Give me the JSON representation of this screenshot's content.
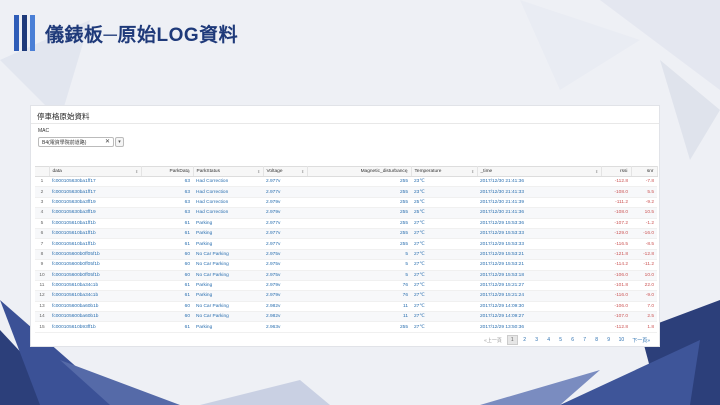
{
  "title": "儀錶板─原始LOG資料",
  "colors": {
    "title": "#1f3a7a",
    "bar1": "#2f5db8",
    "bar2": "#1f3a7a",
    "bar3": "#4a7fd6",
    "link": "#2a6fb0"
  },
  "panel": {
    "title": "停車格原始資料",
    "mac_label": "MAC",
    "mac_value": "B4(電資學院前道路)",
    "clear_icon": "✕",
    "dropdown_icon": "▾"
  },
  "table": {
    "columns": [
      "data",
      "ParkData",
      "ParkStatus",
      "Voltage",
      "Magnetic_disturbance",
      "Temperature",
      "_time",
      "rssi",
      "snr"
    ],
    "rows": [
      [
        "1",
        "fc000105630ba1ff17",
        "63",
        "Had Correction",
        "2.977v",
        "255",
        "23℃",
        "2017/12/30 21:41:36",
        "-112.8",
        "-7.8"
      ],
      [
        "2",
        "fc000105630ba1ff17",
        "63",
        "Had Correction",
        "2.977v",
        "255",
        "23℃",
        "2017/12/30 21:41:33",
        "-108.0",
        "5.5"
      ],
      [
        "3",
        "fc000105630ba3ff19",
        "63",
        "Had Correction",
        "2.979v",
        "255",
        "25℃",
        "2017/12/30 21:41:39",
        "-111.2",
        "-9.2"
      ],
      [
        "4",
        "fc000105630ba3ff19",
        "63",
        "Had Correction",
        "2.979v",
        "255",
        "25℃",
        "2017/12/30 21:41:36",
        "-108.0",
        "10.5"
      ],
      [
        "5",
        "fc000105610ba1ff1b",
        "61",
        "Parking",
        "2.977v",
        "255",
        "27℃",
        "2017/12/29 15:53:36",
        "-107.2",
        "-1.2"
      ],
      [
        "6",
        "fc000105610ba1ff1b",
        "61",
        "Parking",
        "2.977v",
        "255",
        "27℃",
        "2017/12/29 15:53:33",
        "-129.0",
        "-16.0"
      ],
      [
        "7",
        "fc000105610ba1ff1b",
        "61",
        "Parking",
        "2.977v",
        "255",
        "27℃",
        "2017/12/29 15:53:33",
        "-116.5",
        "-8.5"
      ],
      [
        "8",
        "fc000105600b0ff05f1b",
        "60",
        "No Car Parking",
        "2.975v",
        "5",
        "27℃",
        "2017/12/29 15:53:21",
        "-121.8",
        "-12.8"
      ],
      [
        "9",
        "fc000105600b0ff05f1b",
        "60",
        "No Car Parking",
        "2.975v",
        "5",
        "27℃",
        "2017/12/29 15:53:21",
        "-114.2",
        "-11.2"
      ],
      [
        "10",
        "fc000105600b0ff05f1b",
        "60",
        "No Car Parking",
        "2.975v",
        "5",
        "27℃",
        "2017/12/29 15:53:18",
        "-106.0",
        "10.0"
      ],
      [
        "11",
        "fc000105610ba34c1b",
        "61",
        "Parking",
        "2.979v",
        "76",
        "27℃",
        "2017/12/29 15:21:27",
        "-101.8",
        "22.0"
      ],
      [
        "12",
        "fc000105610ba34c1b",
        "61",
        "Parking",
        "2.979v",
        "76",
        "27℃",
        "2017/12/29 15:21:24",
        "-116.0",
        "-9.0"
      ],
      [
        "13",
        "fc000105600ba60b1b",
        "60",
        "No Car Parking",
        "2.982v",
        "11",
        "27℃",
        "2017/12/29 14:09:30",
        "-106.0",
        "7.0"
      ],
      [
        "14",
        "fc000105600ba60b1b",
        "60",
        "No Car Parking",
        "2.982v",
        "11",
        "27℃",
        "2017/12/29 14:09:27",
        "-107.0",
        "2.5"
      ],
      [
        "15",
        "fc000105610b93ff1b",
        "61",
        "Parking",
        "2.963v",
        "255",
        "27℃",
        "2017/12/29 13:50:36",
        "-112.8",
        "1.8"
      ]
    ]
  },
  "pager": {
    "prev": "«上一頁",
    "pages": [
      "1",
      "2",
      "3",
      "4",
      "5",
      "6",
      "7",
      "8",
      "9",
      "10"
    ],
    "next": "下一頁»"
  }
}
